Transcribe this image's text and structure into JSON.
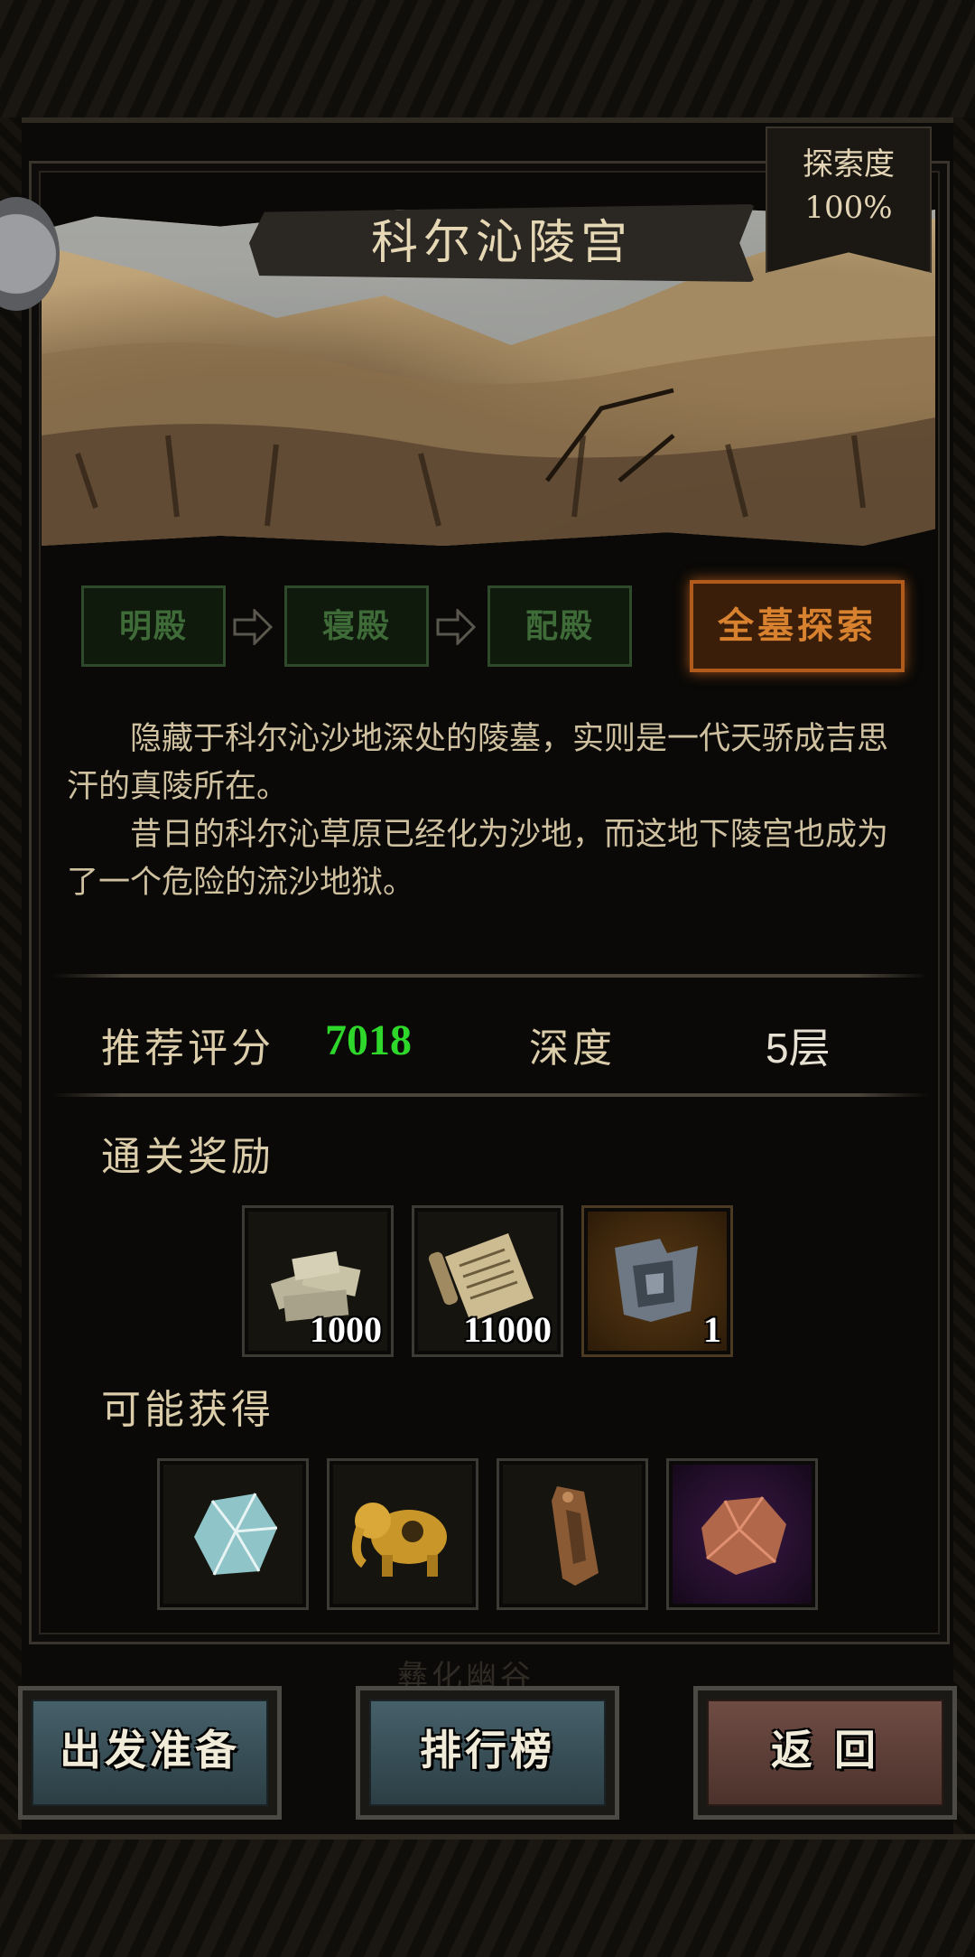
{
  "exploration": {
    "label": "探索度",
    "value": "100%"
  },
  "location": {
    "title": "科尔沁陵宫"
  },
  "stages": [
    {
      "label": "明殿"
    },
    {
      "label": "寝殿"
    },
    {
      "label": "配殿"
    }
  ],
  "full_explore": {
    "label": "全墓探索"
  },
  "description": {
    "p1": "隐藏于科尔沁沙地深处的陵墓，实则是一代天骄成吉思汗的真陵所在。",
    "p2": "昔日的科尔沁草原已经化为沙地，而这地下陵宫也成为了一个危险的流沙地狱。"
  },
  "stats": {
    "score_label": "推荐评分",
    "score_value": "7018",
    "depth_label": "深度",
    "depth_value": "5层"
  },
  "rewards": {
    "title": "通关奖励",
    "items": [
      {
        "icon": "money-stack-icon",
        "qty": "1000"
      },
      {
        "icon": "scroll-icon",
        "qty": "11000"
      },
      {
        "icon": "map-fragment-icon",
        "qty": "1"
      }
    ]
  },
  "possible": {
    "title": "可能获得",
    "items": [
      {
        "icon": "crystal-ore-icon"
      },
      {
        "icon": "golden-elephant-icon"
      },
      {
        "icon": "bronze-tablet-icon"
      },
      {
        "icon": "copper-ore-icon"
      }
    ]
  },
  "faded_text": "彝化幽谷",
  "buttons": {
    "prepare": "出发准备",
    "ranking": "排行榜",
    "back": "返 回"
  },
  "colors": {
    "score_green": "#2ed82a",
    "active_orange": "#d8822f",
    "stage_green": "#3f6b38"
  }
}
